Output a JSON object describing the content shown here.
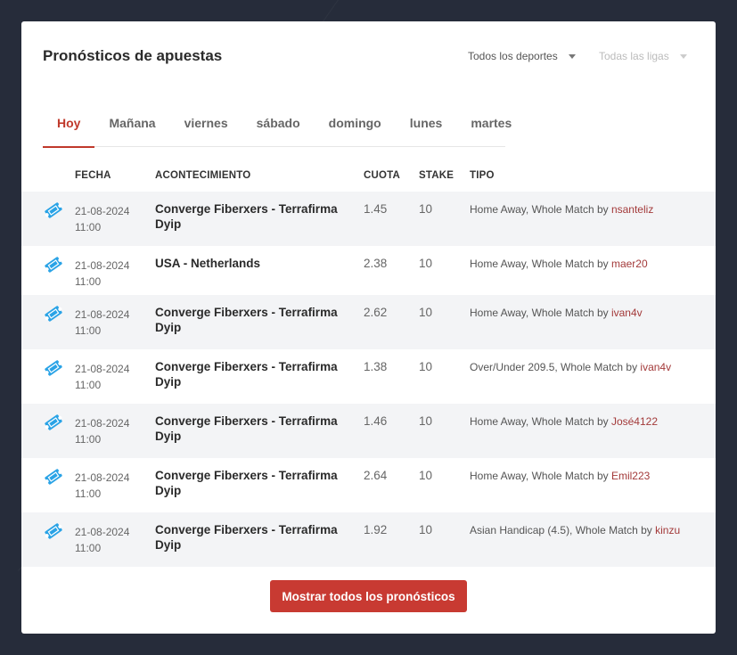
{
  "header": {
    "title": "Pronósticos de apuestas",
    "sport_filter": "Todos los deportes",
    "league_filter": "Todas las ligas"
  },
  "tabs": [
    {
      "label": "Hoy",
      "active": true
    },
    {
      "label": "Mañana",
      "active": false
    },
    {
      "label": "viernes",
      "active": false
    },
    {
      "label": "sábado",
      "active": false
    },
    {
      "label": "domingo",
      "active": false
    },
    {
      "label": "lunes",
      "active": false
    },
    {
      "label": "martes",
      "active": false
    }
  ],
  "table": {
    "columns": {
      "fecha": "FECHA",
      "acontecimiento": "ACONTECIMIENTO",
      "cuota": "CUOTA",
      "stake": "STAKE",
      "tipo": "TIPO"
    },
    "rows": [
      {
        "icon": "ticket-icon",
        "date": "21-08-2024",
        "time": "11:00",
        "event": "Converge Fiberxers - Terrafirma Dyip",
        "odds": "1.45",
        "stake": "10",
        "type": "Home Away, Whole Match by",
        "user": "nsanteliz"
      },
      {
        "icon": "ticket-icon",
        "date": "21-08-2024",
        "time": "11:00",
        "event": "USA - Netherlands",
        "odds": "2.38",
        "stake": "10",
        "type": "Home Away, Whole Match by",
        "user": "maer20"
      },
      {
        "icon": "ticket-icon",
        "date": "21-08-2024",
        "time": "11:00",
        "event": "Converge Fiberxers - Terrafirma Dyip",
        "odds": "2.62",
        "stake": "10",
        "type": "Home Away, Whole Match by",
        "user": "ivan4v"
      },
      {
        "icon": "ticket-icon",
        "date": "21-08-2024",
        "time": "11:00",
        "event": "Converge Fiberxers - Terrafirma Dyip",
        "odds": "1.38",
        "stake": "10",
        "type": "Over/Under 209.5, Whole Match by",
        "user": "ivan4v"
      },
      {
        "icon": "ticket-icon",
        "date": "21-08-2024",
        "time": "11:00",
        "event": "Converge Fiberxers - Terrafirma Dyip",
        "odds": "1.46",
        "stake": "10",
        "type": "Home Away, Whole Match by",
        "user": "José4122"
      },
      {
        "icon": "ticket-icon",
        "date": "21-08-2024",
        "time": "11:00",
        "event": "Converge Fiberxers - Terrafirma Dyip",
        "odds": "2.64",
        "stake": "10",
        "type": "Home Away, Whole Match by",
        "user": "Emil223"
      },
      {
        "icon": "ticket-icon",
        "date": "21-08-2024",
        "time": "11:00",
        "event": "Converge Fiberxers - Terrafirma Dyip",
        "odds": "1.92",
        "stake": "10",
        "type": "Asian Handicap (4.5), Whole Match by",
        "user": "kinzu"
      }
    ]
  },
  "footer": {
    "show_all_label": "Mostrar todos los pronósticos"
  },
  "colors": {
    "accent": "#c0392b",
    "button": "#c83a32",
    "icon": "#2aa3e6",
    "username": "#a33a3a",
    "background": "#262c3a"
  }
}
